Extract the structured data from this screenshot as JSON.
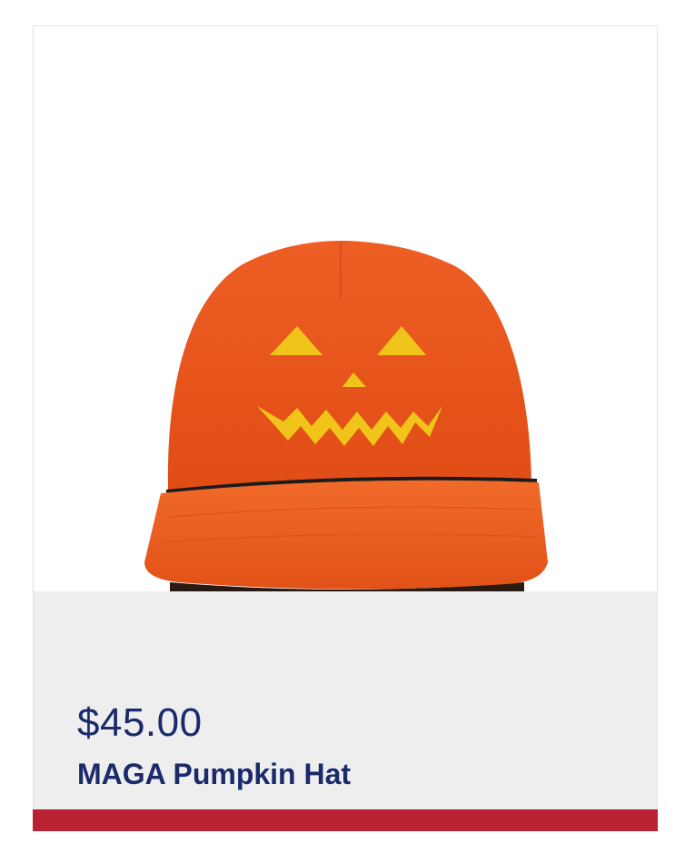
{
  "product": {
    "price": "$45.00",
    "name": "MAGA Pumpkin Hat"
  },
  "image": {
    "subject": "orange-cap-with-jack-o-lantern-face"
  },
  "colors": {
    "panel": "#eeeeef",
    "text": "#1b2a6b",
    "accent": "#b82233",
    "hat": "#e9561c",
    "embroidery": "#f0c419"
  }
}
